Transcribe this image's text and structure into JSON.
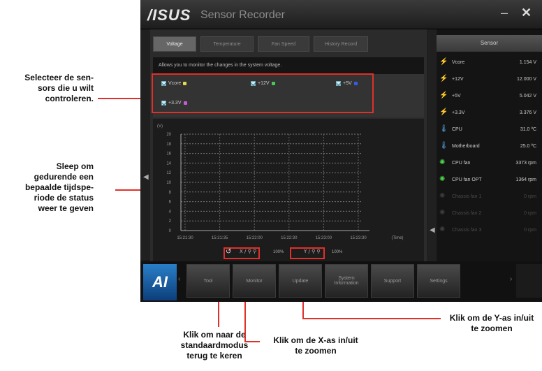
{
  "window": {
    "brand": "/ISUS",
    "title": "Sensor Recorder",
    "minimize": "–",
    "close": "✕"
  },
  "tabs": [
    "Voltage",
    "Temperature",
    "Fan Speed",
    "History Record"
  ],
  "description": "Allows you to monitor the changes in the system voltage.",
  "selections": [
    {
      "label": "Vcore",
      "color": "#e8d84a"
    },
    {
      "label": "+12V",
      "color": "#4ac85a"
    },
    {
      "label": "+5V",
      "color": "#3a5ae8"
    },
    {
      "label": "+3.3V",
      "color": "#c85ad8"
    }
  ],
  "chart_data": {
    "type": "line",
    "ylabel": "(V)",
    "xlabel": "(Time)",
    "y_ticks": [
      "20",
      "18",
      "16",
      "14",
      "12",
      "10",
      "8",
      "6",
      "4",
      "2",
      "0"
    ],
    "x_ticks": [
      "15:21:30",
      "15:21:35",
      "15:22:00",
      "15:22:30",
      "15:23:00",
      "15:23:30"
    ],
    "x_zoom": "100%",
    "y_zoom": "100%",
    "reset_icon": "↺",
    "zoom_x_icons": "X / ⚲ ⚲",
    "zoom_y_icons": "Y / ⚲ ⚲"
  },
  "sensor": {
    "header": "Sensor",
    "rows": [
      {
        "name": "Vcore",
        "value": "1.154 V",
        "icon": "⚡",
        "color": "#4ad84a",
        "active": true
      },
      {
        "name": "+12V",
        "value": "12.000 V",
        "icon": "⚡",
        "color": "#4ad84a",
        "active": true
      },
      {
        "name": "+5V",
        "value": "5.042 V",
        "icon": "⚡",
        "color": "#4ad84a",
        "active": true
      },
      {
        "name": "+3.3V",
        "value": "3.376 V",
        "icon": "⚡",
        "color": "#4ad84a",
        "active": true
      },
      {
        "name": "CPU",
        "value": "31.0 ºC",
        "icon": "🌡",
        "color": "#5aa8e8",
        "active": true
      },
      {
        "name": "Motherboard",
        "value": "25.0 ºC",
        "icon": "🌡",
        "color": "#5aa8e8",
        "active": true
      },
      {
        "name": "CPU fan",
        "value": "3373 rpm",
        "icon": "✺",
        "color": "#4ad84a",
        "active": true
      },
      {
        "name": "CPU fan OPT",
        "value": "1364 rpm",
        "icon": "✺",
        "color": "#4ad84a",
        "active": true
      },
      {
        "name": "Chassis fan 1",
        "value": "0 rpm",
        "icon": "✺",
        "color": "#3d3d3d",
        "active": false
      },
      {
        "name": "Chassis fan 2",
        "value": "0 rpm",
        "icon": "✺",
        "color": "#3d3d3d",
        "active": false
      },
      {
        "name": "Chassis fan 3",
        "value": "0 rpm",
        "icon": "✺",
        "color": "#3d3d3d",
        "active": false
      }
    ]
  },
  "bottom_nav": {
    "logo": "AI",
    "items": [
      "Tool",
      "Monitor",
      "Update",
      "System Information",
      "Support",
      "Settings"
    ],
    "prev": "‹",
    "next": "›"
  },
  "annotations": {
    "select_sensors": "Selecteer de sen-\nsors die u wilt\ncontroleren.",
    "drag_period": "Sleep om\ngedurende een\nbepaalde tijdspe-\nriode de status\nweer te geven",
    "reset_default": "Klik om naar de\nstandaardmodus\nterug te keren",
    "zoom_x": "Klik om de X-as in/uit\nte zoomen",
    "zoom_y": "Klik om de Y-as in/uit\nte zoomen"
  }
}
